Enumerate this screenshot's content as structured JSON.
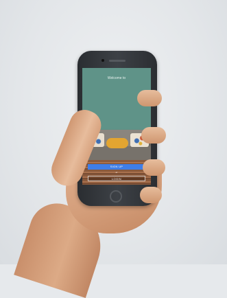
{
  "screen": {
    "welcome_text": "Welcome to",
    "signup_label": "SIGN UP",
    "divider_text": "or",
    "login_label": "LOGIN"
  },
  "colors": {
    "screen_background": "#5f9388",
    "signup_button": "#3f7ee8",
    "phone_body": "#2f3236"
  }
}
